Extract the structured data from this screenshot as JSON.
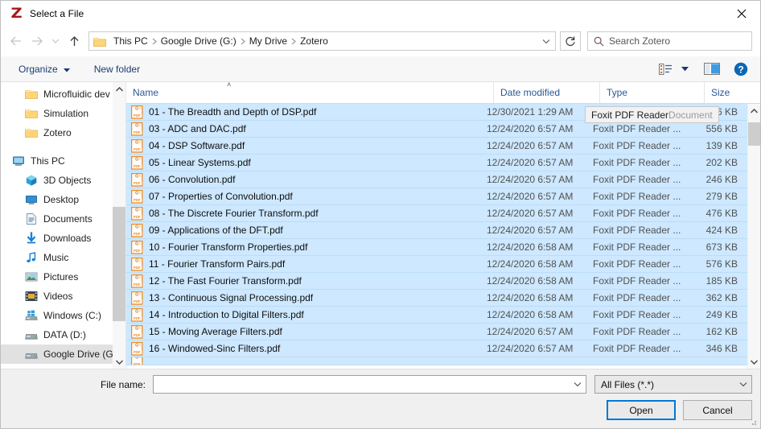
{
  "window": {
    "title": "Select a File",
    "app_icon": "zotero-z-icon",
    "logo_color": "#a4191b",
    "close_label": "✕"
  },
  "nav": {
    "back": "back-arrow",
    "forward": "forward-arrow",
    "recent": "recent-locations-chevron",
    "up": "up-arrow",
    "folder_icon": "folder-icon",
    "breadcrumbs": [
      "This PC",
      "Google Drive (G:)",
      "My Drive",
      "Zotero"
    ],
    "breadcrumb_separator": "❯",
    "address_dropdown": "chevron-down-icon",
    "refresh": "refresh-icon"
  },
  "search": {
    "placeholder": "Search Zotero",
    "icon": "search-icon"
  },
  "commandbar": {
    "organize_label": "Organize",
    "organize_caret": "▼",
    "new_folder_label": "New folder",
    "view_icon": "view-list-icon",
    "view_caret": "▼",
    "pane_icon": "preview-pane-icon",
    "help_icon": "help-icon",
    "accent": "#0078d7"
  },
  "sidebar": {
    "items": [
      {
        "label": "Microfluidic dev",
        "icon": "folder-icon",
        "indent": 1,
        "selected": false
      },
      {
        "label": "Simulation",
        "icon": "folder-icon",
        "indent": 1,
        "selected": false
      },
      {
        "label": "Zotero",
        "icon": "folder-icon",
        "indent": 1,
        "selected": false
      },
      {
        "label": "This PC",
        "icon": "this-pc-icon",
        "indent": 0,
        "selected": false,
        "gap_before": true
      },
      {
        "label": "3D Objects",
        "icon": "3d-objects-icon",
        "indent": 2,
        "selected": false
      },
      {
        "label": "Desktop",
        "icon": "desktop-icon",
        "indent": 2,
        "selected": false
      },
      {
        "label": "Documents",
        "icon": "documents-icon",
        "indent": 2,
        "selected": false
      },
      {
        "label": "Downloads",
        "icon": "downloads-icon",
        "indent": 2,
        "selected": false
      },
      {
        "label": "Music",
        "icon": "music-icon",
        "indent": 2,
        "selected": false
      },
      {
        "label": "Pictures",
        "icon": "pictures-icon",
        "indent": 2,
        "selected": false
      },
      {
        "label": "Videos",
        "icon": "videos-icon",
        "indent": 2,
        "selected": false
      },
      {
        "label": "Windows (C:)",
        "icon": "windows-drive-icon",
        "indent": 2,
        "selected": false
      },
      {
        "label": "DATA (D:)",
        "icon": "drive-icon",
        "indent": 2,
        "selected": false
      },
      {
        "label": "Google Drive (G:",
        "icon": "drive-icon",
        "indent": 2,
        "selected": true
      }
    ]
  },
  "filelist": {
    "columns": {
      "name": "Name",
      "date_modified": "Date modified",
      "type": "Type",
      "size": "Size"
    },
    "sort_column": "Name",
    "sort_direction": "ascending",
    "sort_caret": "˄",
    "selection_color": "#cde8ff",
    "tooltip": {
      "text_primary": "Foxit PDF Reader ",
      "text_dim": "Document"
    },
    "rows": [
      {
        "name": "01 - The Breadth and Depth of DSP.pdf",
        "date": "12/30/2021 1:29 AM",
        "type": "Foxit PDF Reader ...",
        "size": "46 KB"
      },
      {
        "name": "03 - ADC and DAC.pdf",
        "date": "12/24/2020 6:57 AM",
        "type": "Foxit PDF Reader ...",
        "size": "556 KB"
      },
      {
        "name": "04 - DSP Software.pdf",
        "date": "12/24/2020 6:57 AM",
        "type": "Foxit PDF Reader ...",
        "size": "139 KB"
      },
      {
        "name": "05 - Linear Systems.pdf",
        "date": "12/24/2020 6:57 AM",
        "type": "Foxit PDF Reader ...",
        "size": "202 KB"
      },
      {
        "name": "06 - Convolution.pdf",
        "date": "12/24/2020 6:57 AM",
        "type": "Foxit PDF Reader ...",
        "size": "246 KB"
      },
      {
        "name": "07 - Properties of Convolution.pdf",
        "date": "12/24/2020 6:57 AM",
        "type": "Foxit PDF Reader ...",
        "size": "279 KB"
      },
      {
        "name": "08 - The Discrete Fourier Transform.pdf",
        "date": "12/24/2020 6:57 AM",
        "type": "Foxit PDF Reader ...",
        "size": "476 KB"
      },
      {
        "name": "09 - Applications of the DFT.pdf",
        "date": "12/24/2020 6:57 AM",
        "type": "Foxit PDF Reader ...",
        "size": "424 KB"
      },
      {
        "name": "10 - Fourier Transform Properties.pdf",
        "date": "12/24/2020 6:58 AM",
        "type": "Foxit PDF Reader ...",
        "size": "673 KB"
      },
      {
        "name": "11 - Fourier Transform Pairs.pdf",
        "date": "12/24/2020 6:58 AM",
        "type": "Foxit PDF Reader ...",
        "size": "576 KB"
      },
      {
        "name": "12 - The Fast Fourier Transform.pdf",
        "date": "12/24/2020 6:58 AM",
        "type": "Foxit PDF Reader ...",
        "size": "185 KB"
      },
      {
        "name": "13 - Continuous Signal Processing.pdf",
        "date": "12/24/2020 6:58 AM",
        "type": "Foxit PDF Reader ...",
        "size": "362 KB"
      },
      {
        "name": "14 - Introduction to Digital Filters.pdf",
        "date": "12/24/2020 6:58 AM",
        "type": "Foxit PDF Reader ...",
        "size": "249 KB"
      },
      {
        "name": "15 - Moving Average Filters.pdf",
        "date": "12/24/2020 6:57 AM",
        "type": "Foxit PDF Reader ...",
        "size": "162 KB"
      },
      {
        "name": "16 - Windowed-Sinc Filters.pdf",
        "date": "12/24/2020 6:57 AM",
        "type": "Foxit PDF Reader ...",
        "size": "346 KB"
      }
    ]
  },
  "footer": {
    "filename_label": "File name:",
    "filename_value": "",
    "filename_placeholder": "",
    "filetype_value": "All Files (*.*)",
    "open_label": "Open",
    "cancel_label": "Cancel"
  }
}
